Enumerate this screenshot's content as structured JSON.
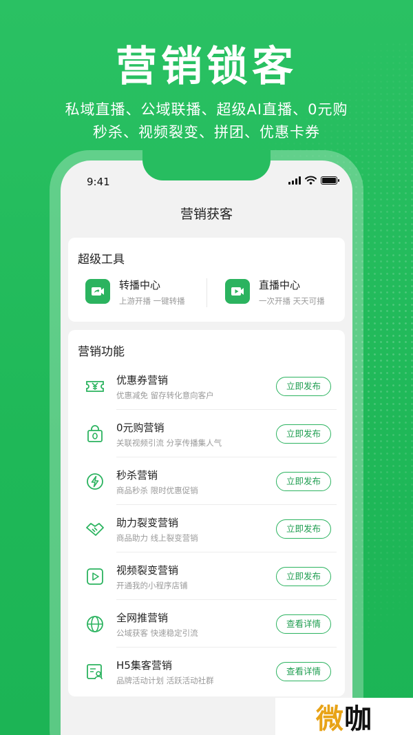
{
  "hero": {
    "title": "营销锁客",
    "subtitle_line1": "私域直播、公域联播、超级AI直播、0元购",
    "subtitle_line2": "秒杀、视频裂变、拼团、优惠卡券"
  },
  "status_bar": {
    "time": "9:41"
  },
  "page": {
    "title": "营销获客"
  },
  "tools_section": {
    "title": "超级工具",
    "items": [
      {
        "name": "转播中心",
        "desc": "上游开播 一键转播",
        "icon": "relay-icon"
      },
      {
        "name": "直播中心",
        "desc": "一次开播 天天可播",
        "icon": "video-camera-icon"
      }
    ]
  },
  "features_section": {
    "title": "营销功能",
    "items": [
      {
        "name": "优惠券营销",
        "desc": "优惠减免 留存转化意向客户",
        "button": "立即发布",
        "icon": "coupon-icon"
      },
      {
        "name": "0元购营销",
        "desc": "关联视频引流 分享传播集人气",
        "button": "立即发布",
        "icon": "zero-bag-icon"
      },
      {
        "name": "秒杀营销",
        "desc": "商品秒杀 限时优惠促销",
        "button": "立即发布",
        "icon": "lightning-icon"
      },
      {
        "name": "助力裂变营销",
        "desc": "商品助力 线上裂变营销",
        "button": "立即发布",
        "icon": "handshake-icon"
      },
      {
        "name": "视频裂变营销",
        "desc": "开通我的小程序店铺",
        "button": "立即发布",
        "icon": "play-icon"
      },
      {
        "name": "全网推营销",
        "desc": "公域获客 快速稳定引流",
        "button": "查看详情",
        "icon": "globe-icon"
      },
      {
        "name": "H5集客营销",
        "desc": "品牌活动计划 活跃活动社群",
        "button": "查看详情",
        "icon": "h5-profile-icon"
      }
    ]
  },
  "watermark": {
    "first": "微",
    "rest": "咖"
  },
  "colors": {
    "brand_green": "#1fb858",
    "accent_green": "#2bb35f"
  }
}
